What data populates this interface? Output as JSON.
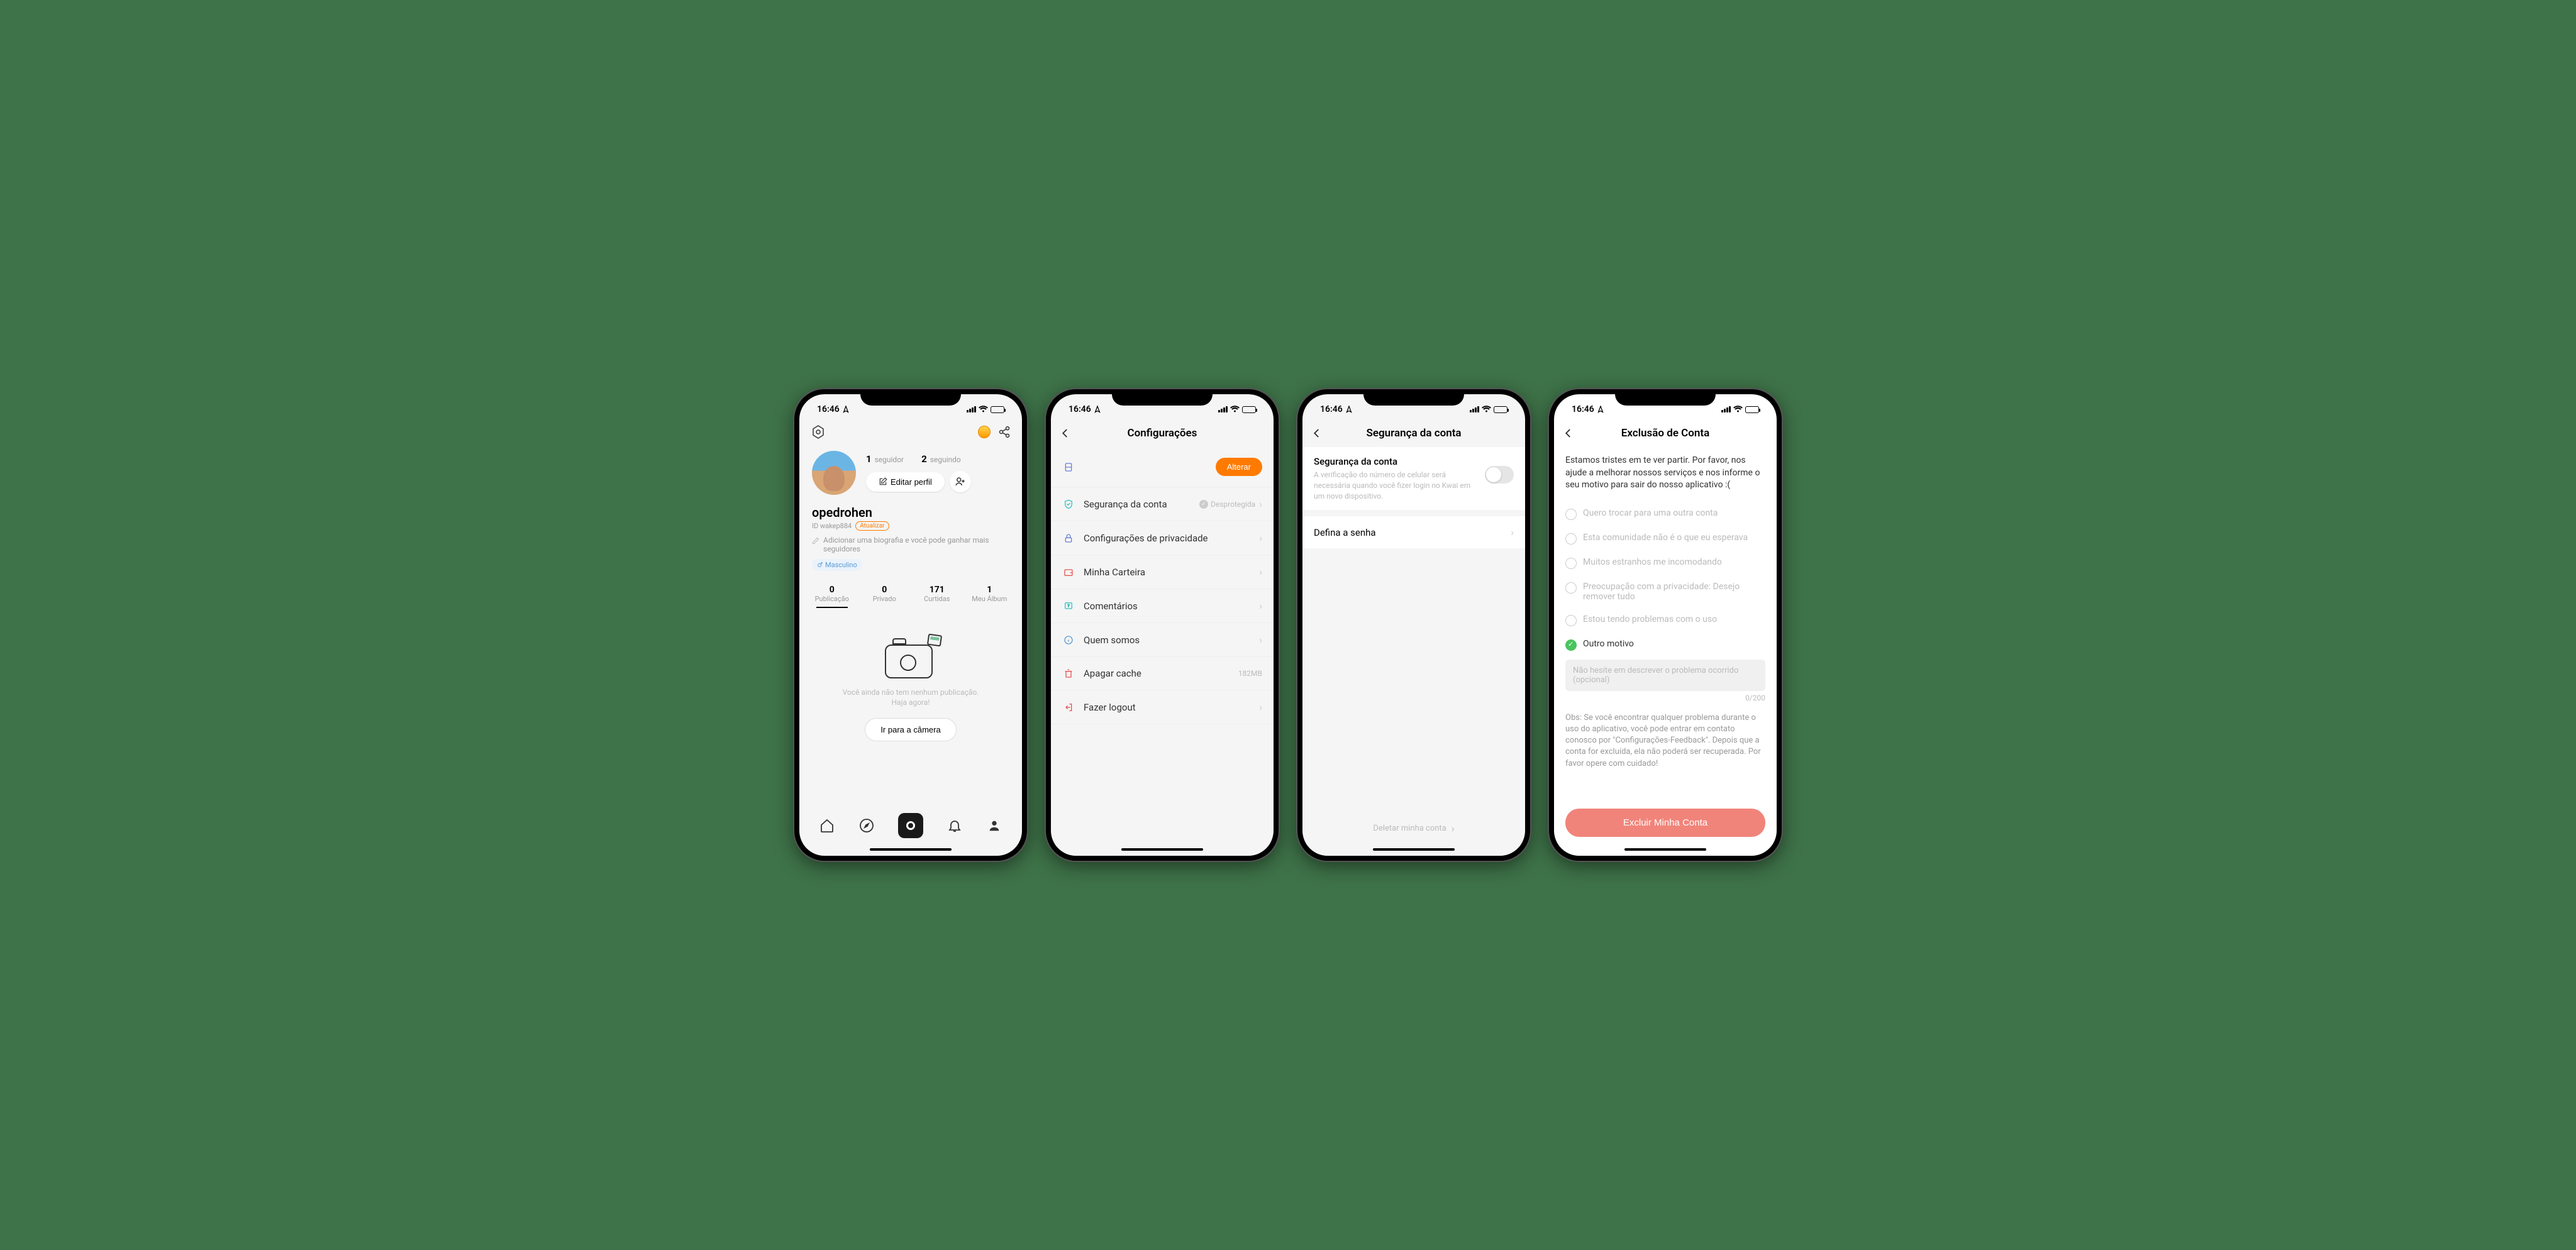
{
  "status": {
    "time": "16:46"
  },
  "phone1": {
    "followers": {
      "count": "1",
      "label": "seguidor"
    },
    "following": {
      "count": "2",
      "label": "seguindo"
    },
    "edit_profile": "Editar perfil",
    "username": "opedrohen",
    "userid": "ID wakep884",
    "update_badge": "Atualizar",
    "bio_hint": "Adicionar uma biografia e você pode ganhar mais seguidores",
    "gender": "Masculino",
    "stats": {
      "posts": {
        "count": "0",
        "label": "Publicação"
      },
      "private": {
        "count": "0",
        "label": "Privado"
      },
      "likes": {
        "count": "171",
        "label": "Curtidas"
      },
      "album": {
        "count": "1",
        "label": "Meu Álbum"
      }
    },
    "empty_line1": "Você ainda não tem nenhum publicação.",
    "empty_line2": "Haja agora!",
    "camera_btn": "Ir para a câmera"
  },
  "phone2": {
    "title": "Configurações",
    "alter": "Alterar",
    "security": "Segurança da conta",
    "security_status": "Desprotegida",
    "privacy": "Configurações de privacidade",
    "wallet": "Minha Carteira",
    "comments": "Comentários",
    "about": "Quem somos",
    "cache": "Apagar cache",
    "cache_size": "182MB",
    "logout": "Fazer logout"
  },
  "phone3": {
    "title": "Segurança da conta",
    "section_title": "Segurança da conta",
    "section_desc": "A verificação do número de celular será necessária quando você fizer login no Kwai em um novo dispositivo.",
    "set_password": "Defina a senha",
    "delete": "Deletar minha conta"
  },
  "phone4": {
    "title": "Exclusão de Conta",
    "intro": "Estamos tristes em te ver partir. Por favor, nos ajude a melhorar nossos serviços e nos informe o seu motivo para sair do nosso aplicativo :(",
    "options": {
      "switch": "Quero trocar para uma outra conta",
      "community": "Esta comunidade não é o que eu esperava",
      "strangers": "Muitos estranhos me incomodando",
      "privacy": "Preocupação com a privacidade: Desejo remover tudo",
      "problems": "Estou tendo problemas com o uso",
      "other": "Outro motivo"
    },
    "placeholder": "Não hesite em descrever o problema ocorrido (opcional)",
    "char_count": "0/200",
    "obs": "Obs: Se você encontrar qualquer problema durante o uso do aplicativo, você pode entrar em contato conosco por \"Configurações-Feedback\". Depois que a conta for excluída, ela não poderá ser recuperada. Por favor opere com cuidado!",
    "delete_btn": "Excluir Minha Conta"
  }
}
